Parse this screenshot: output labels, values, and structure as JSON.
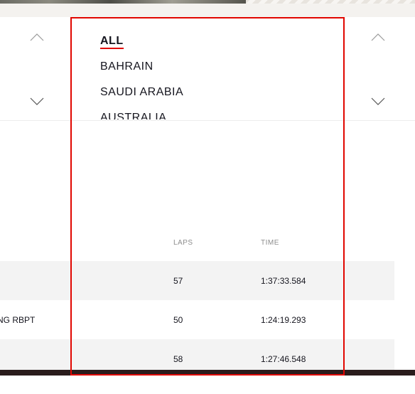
{
  "selector": {
    "races": [
      "ALL",
      "BAHRAIN",
      "SAUDI ARABIA",
      "AUSTRALIA"
    ],
    "active_race": "ALL"
  },
  "table": {
    "headers": {
      "laps": "LAPS",
      "time": "TIME"
    },
    "rows": [
      {
        "car": "",
        "laps": "57",
        "time": "1:37:33.584"
      },
      {
        "car": "NG RBPT",
        "laps": "50",
        "time": "1:24:19.293"
      },
      {
        "car": "",
        "laps": "58",
        "time": "1:27:46.548"
      }
    ]
  },
  "colors": {
    "accent": "#e10600",
    "row_alt": "#f3f3f3",
    "text": "#15151e"
  }
}
